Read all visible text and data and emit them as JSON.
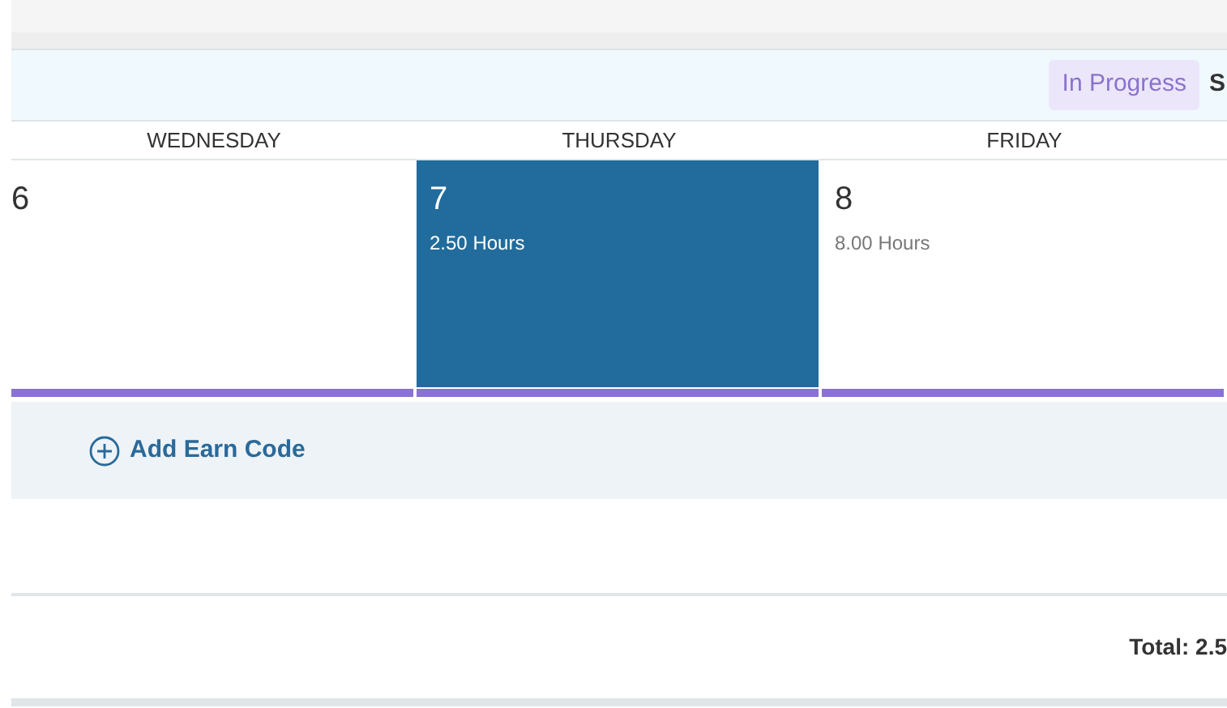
{
  "status_badge": "In Progress",
  "header_cut_text": "S",
  "days": [
    {
      "name": "WEDNESDAY",
      "date": "6",
      "selected": false
    },
    {
      "name": "THURSDAY",
      "date": "7",
      "hours": "2.50 Hours",
      "selected": true
    },
    {
      "name": "FRIDAY",
      "date": "8",
      "hours": "8.00 Hours",
      "selected": false
    }
  ],
  "add_button": "Add Earn Code",
  "total": "Total: 2.5"
}
